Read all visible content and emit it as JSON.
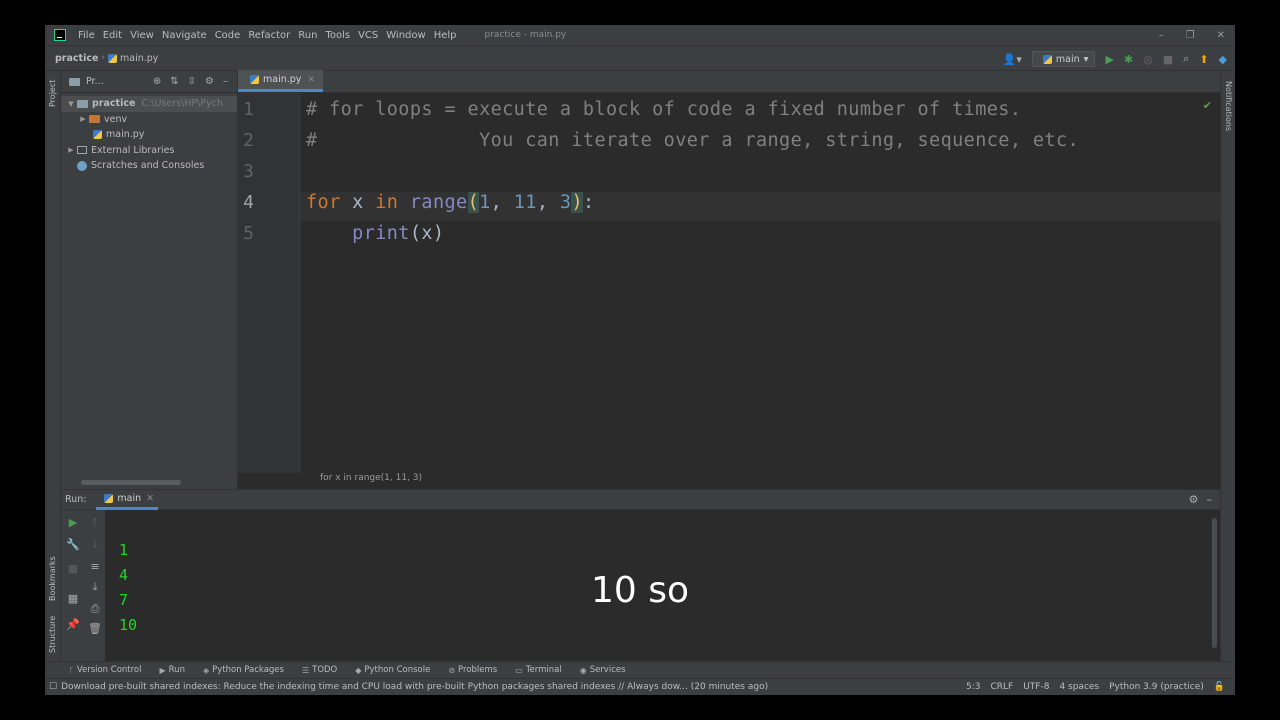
{
  "window": {
    "title": "practice - main.py",
    "menu": [
      "File",
      "Edit",
      "View",
      "Navigate",
      "Code",
      "Refactor",
      "Run",
      "Tools",
      "VCS",
      "Window",
      "Help"
    ],
    "controls": [
      "–",
      "❐",
      "✕"
    ]
  },
  "navbar": {
    "project": "practice",
    "file": "main.py",
    "run_config": "main"
  },
  "project_panel": {
    "title": "Pr...",
    "tree": [
      {
        "label": "practice",
        "path": "C:\\Users\\HP\\Pych"
      },
      {
        "label": "venv"
      },
      {
        "label": "main.py"
      },
      {
        "label": "External Libraries"
      },
      {
        "label": "Scratches and Consoles"
      }
    ]
  },
  "side_labels": {
    "project": "Project",
    "bookmarks": "Bookmarks",
    "structure": "Structure",
    "notifications": "Notifications"
  },
  "editor": {
    "tab": "main.py",
    "line_numbers": [
      "1",
      "2",
      "3",
      "4",
      "5"
    ],
    "lines": {
      "l1": "# for loops = execute a block of code a fixed number of times.",
      "l2": "#              You can iterate over a range, string, sequence, etc.",
      "l4": {
        "kw_for": "for",
        "var": " x ",
        "kw_in": "in",
        "fn": " range",
        "open": "(",
        "a": "1",
        "sep1": ", ",
        "b": "11",
        "sep2": ", ",
        "c": "3",
        "close": ")",
        "colon": ":"
      },
      "l5": {
        "indent": "    ",
        "fn": "print",
        "args": "(x)"
      }
    },
    "breadcrumb_hint": "for x in range(1, 11, 3)"
  },
  "run_panel": {
    "label": "Run:",
    "tab": "main",
    "output": [
      "1",
      "4",
      "7",
      "10"
    ]
  },
  "caption": "10 so",
  "bottom_tools": [
    "Version Control",
    "Run",
    "Python Packages",
    "TODO",
    "Python Console",
    "Problems",
    "Terminal",
    "Services"
  ],
  "status": {
    "message": "Download pre-built shared indexes: Reduce the indexing time and CPU load with pre-built Python packages shared indexes // Always dow... (20 minutes ago)",
    "position": "5:3",
    "line_sep": "CRLF",
    "encoding": "UTF-8",
    "indent": "4 spaces",
    "interpreter": "Python 3.9 (practice)"
  }
}
